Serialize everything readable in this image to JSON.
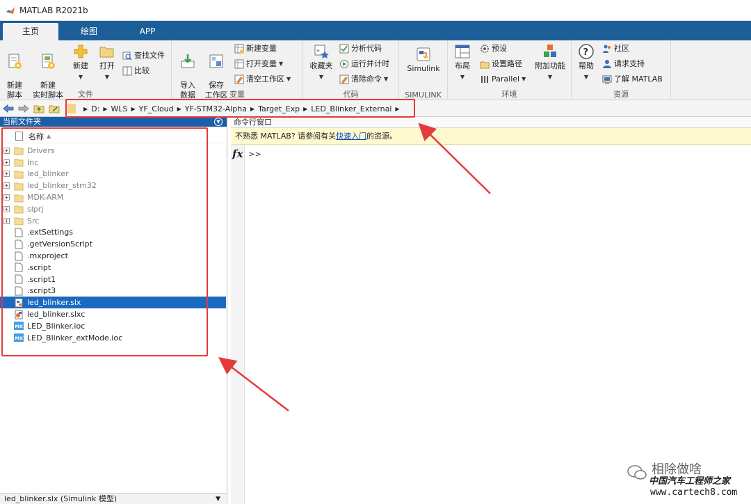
{
  "window": {
    "title": "MATLAB R2021b"
  },
  "tabs": [
    {
      "label": "主页",
      "active": true
    },
    {
      "label": "绘图",
      "active": false
    },
    {
      "label": "APP",
      "active": false
    }
  ],
  "ribbon": {
    "file": {
      "label": "文件",
      "new_script": "新建\n脚本",
      "new_live_script": "新建\n实时脚本",
      "new": "新建",
      "open": "打开",
      "find_files": "查找文件",
      "compare": "比较"
    },
    "variable": {
      "label": "变量",
      "import_data": "导入\n数据",
      "save_workspace": "保存\n工作区",
      "new_variable": "新建变量",
      "open_variable": "打开变量",
      "clear_workspace": "清空工作区"
    },
    "code": {
      "label": "代码",
      "favorites": "收藏夹",
      "analyze_code": "分析代码",
      "run_and_time": "运行并计时",
      "clear_commands": "清除命令"
    },
    "simulink": {
      "label": "SIMULINK",
      "button": "Simulink"
    },
    "environment": {
      "label": "环境",
      "layout": "布局",
      "preferences": "预设",
      "set_path": "设置路径",
      "parallel": "Parallel",
      "addons": "附加功能"
    },
    "resources": {
      "label": "资源",
      "help": "帮助",
      "community": "社区",
      "request_support": "请求支持",
      "learn_matlab": "了解 MATLAB"
    }
  },
  "address_bar": {
    "path": [
      "D:",
      "WLS",
      "YF_Cloud",
      "YF-STM32-Alpha",
      "Target_Exp",
      "LED_Blinker_External"
    ]
  },
  "current_folder": {
    "title": "当前文件夹",
    "column_name": "名称",
    "items": [
      {
        "name": "Drivers",
        "type": "folder"
      },
      {
        "name": "Inc",
        "type": "folder"
      },
      {
        "name": "led_blinker",
        "type": "folder"
      },
      {
        "name": "led_blinker_stm32",
        "type": "folder"
      },
      {
        "name": "MDK-ARM",
        "type": "folder"
      },
      {
        "name": "slprj",
        "type": "folder"
      },
      {
        "name": "Src",
        "type": "folder"
      },
      {
        "name": ".extSettings",
        "type": "file"
      },
      {
        "name": ".getVersionScript",
        "type": "file"
      },
      {
        "name": ".mxproject",
        "type": "file"
      },
      {
        "name": ".script",
        "type": "file"
      },
      {
        "name": ".script1",
        "type": "file"
      },
      {
        "name": ".script3",
        "type": "file"
      },
      {
        "name": "led_blinker.slx",
        "type": "slx",
        "selected": true
      },
      {
        "name": "led_blinker.slxc",
        "type": "slxc"
      },
      {
        "name": "LED_Blinker.ioc",
        "type": "ioc"
      },
      {
        "name": "LED_Blinker_extMode.ioc",
        "type": "ioc"
      }
    ],
    "status": "led_blinker.slx  (Simulink 模型)"
  },
  "command_window": {
    "title": "命令行窗口",
    "tip_prefix": "不熟悉 MATLAB? 请参阅有关",
    "tip_link": "快速入门",
    "tip_suffix": "的资源。",
    "fx": "fx",
    "prompt": ">>"
  },
  "watermark": {
    "name": "相除做啥",
    "brand": "中国汽车工程师之家",
    "url": "www.cartech8.com"
  },
  "colors": {
    "tab_bar": "#1c5e98",
    "selection": "#1b6ac0",
    "annotation_red": "#e53a3a",
    "tip_bg": "#fff9cf"
  }
}
